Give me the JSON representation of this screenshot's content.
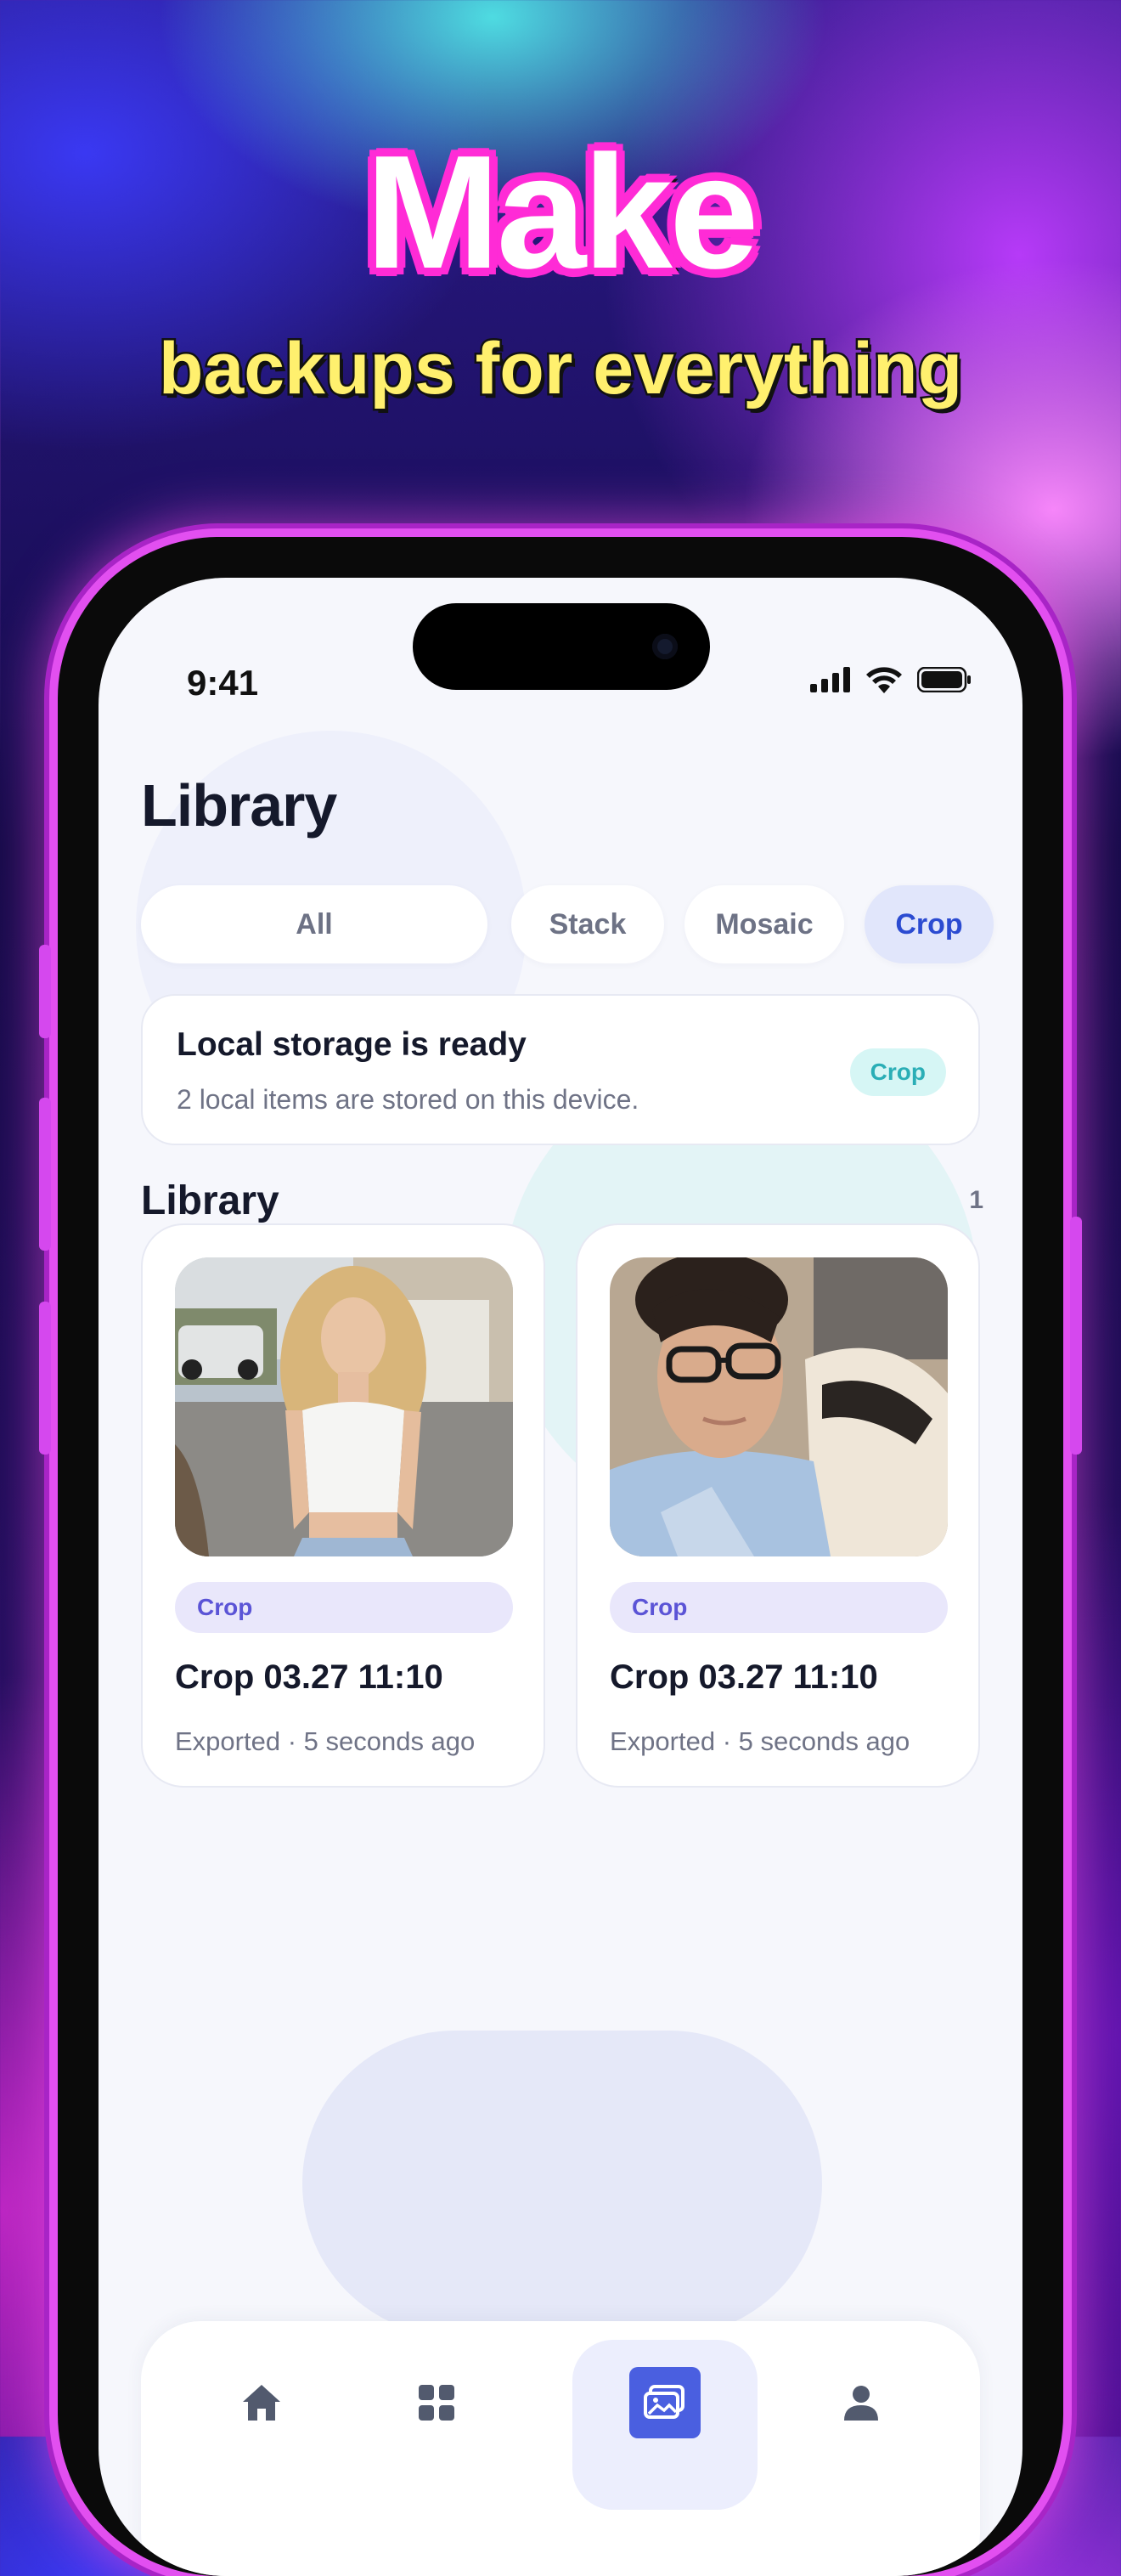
{
  "promo": {
    "headline": "Make",
    "subheadline": "backups for everything"
  },
  "status_bar": {
    "time": "9:41"
  },
  "library": {
    "title": "Library",
    "filters": [
      {
        "label": "All",
        "active": false
      },
      {
        "label": "Stack",
        "active": false
      },
      {
        "label": "Mosaic",
        "active": false
      },
      {
        "label": "Crop",
        "active": true
      }
    ],
    "notice": {
      "title": "Local storage is ready",
      "subtitle": "2 local items are stored on this device.",
      "badge": "Crop"
    },
    "section": {
      "title": "Library",
      "count": "1"
    },
    "items": [
      {
        "badge": "Crop",
        "title": "Crop 03.27 11:10",
        "meta": "Exported · 5 seconds ago",
        "photo": "woman-in-white-top-photo"
      },
      {
        "badge": "Crop",
        "title": "Crop 03.27 11:10",
        "meta": "Exported · 5 seconds ago",
        "photo": "man-with-glasses-selfie-photo"
      }
    ]
  },
  "tab_bar": {
    "tabs": [
      {
        "icon": "home-icon",
        "active": false
      },
      {
        "icon": "grid-icon",
        "active": false
      },
      {
        "icon": "gallery-icon",
        "active": true
      },
      {
        "icon": "profile-icon",
        "active": false
      }
    ]
  },
  "colors": {
    "accent": "#2b4bd1",
    "active_tab": "#4a5fe0",
    "teal_badge": "#2aaeb6",
    "purple_badge": "#5b54d6"
  }
}
